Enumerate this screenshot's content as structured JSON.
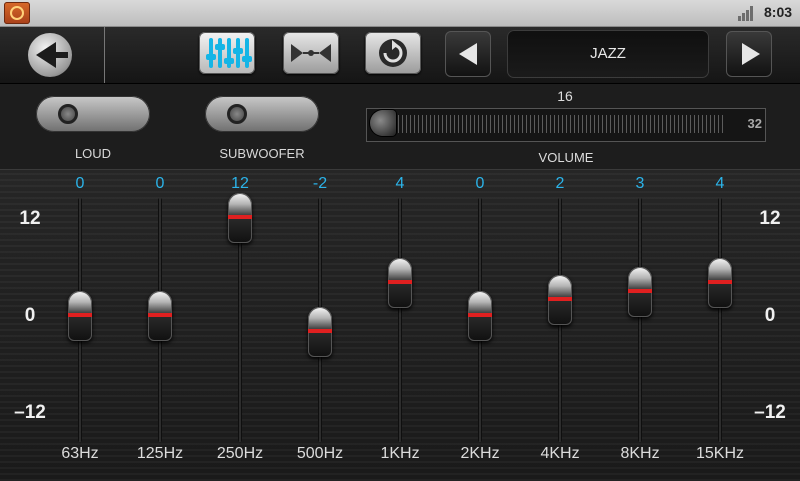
{
  "status_bar": {
    "time": "8:03",
    "icons": [
      "app-icon",
      "signal-icon"
    ]
  },
  "toolbar": {
    "buttons": [
      "back-icon",
      "equalizer-icon",
      "balance-icon",
      "reset-icon",
      "previous-icon",
      "next-icon"
    ],
    "preset": "JAZZ"
  },
  "controls": {
    "loud_label": "LOUD",
    "subwoofer_label": "SUBWOOFER",
    "volume_label": "VOLUME",
    "volume_value": "16",
    "volume_max": "32",
    "volume_fraction": 0.0
  },
  "equalizer": {
    "scale": {
      "top": "12",
      "mid": "0",
      "bottom": "–12"
    },
    "range": [
      -12,
      12
    ],
    "accent_color": "#2bb4ea",
    "bands": [
      {
        "label": "63Hz",
        "value": "0"
      },
      {
        "label": "125Hz",
        "value": "0"
      },
      {
        "label": "250Hz",
        "value": "12"
      },
      {
        "label": "500Hz",
        "value": "-2"
      },
      {
        "label": "1KHz",
        "value": "4"
      },
      {
        "label": "2KHz",
        "value": "0"
      },
      {
        "label": "4KHz",
        "value": "2"
      },
      {
        "label": "8KHz",
        "value": "3"
      },
      {
        "label": "15KHz",
        "value": "4"
      }
    ]
  }
}
